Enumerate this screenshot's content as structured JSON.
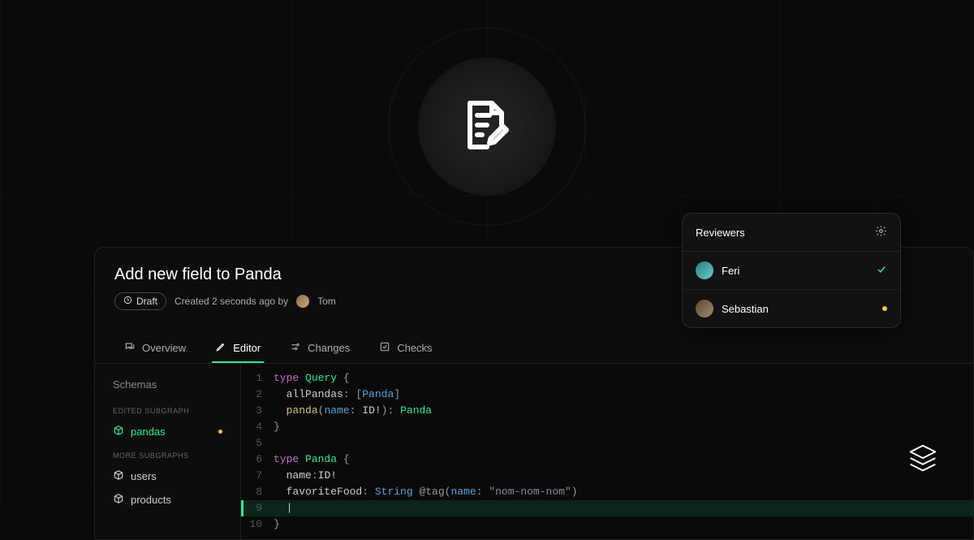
{
  "title": "Add new field to Panda",
  "badge": "Draft",
  "meta": {
    "created": "Created 2 seconds ago by",
    "author": "Tom"
  },
  "tabs": {
    "overview": "Overview",
    "editor": "Editor",
    "changes": "Changes",
    "checks": "Checks"
  },
  "sidebar": {
    "title": "Schemas",
    "section_edited": "EDITED SUBGRAPH",
    "section_more": "MORE SUBGRAPHS",
    "items": {
      "pandas": "pandas",
      "users": "users",
      "products": "products"
    }
  },
  "code": {
    "l1": {
      "kw": "type",
      "name": "Query",
      "open": " {"
    },
    "l2": {
      "indent": "  ",
      "field": "allPandas",
      "colon": ": ",
      "lb": "[",
      "type": "Panda",
      "rb": "]"
    },
    "l3": {
      "indent": "  ",
      "field": "panda",
      "lp": "(",
      "arg": "name",
      "argcolon": ": ",
      "argtype": "ID!",
      "rp": ")",
      "colon": ": ",
      "ret": "Panda"
    },
    "l4": {
      "close": "}"
    },
    "l6": {
      "kw": "type",
      "name": "Panda",
      "open": " {"
    },
    "l7": {
      "indent": "  ",
      "field": "name",
      "colon": ":",
      "type": "ID!"
    },
    "l8": {
      "indent": "  ",
      "field": "favoriteFood",
      "colon": ": ",
      "type": "String",
      "dir": " @tag",
      "lp": "(",
      "arg": "name",
      "argcolon": ": ",
      "str": "\"nom-nom-nom\"",
      "rp": ")"
    },
    "l9": {
      "cursor": "|"
    },
    "l10": {
      "close": "}"
    }
  },
  "lineno": {
    "1": "1",
    "2": "2",
    "3": "3",
    "4": "4",
    "5": "5",
    "6": "6",
    "7": "7",
    "8": "8",
    "9": "9",
    "10": "10"
  },
  "reviewers": {
    "title": "Reviewers",
    "r1": "Feri",
    "r2": "Sebastian"
  }
}
